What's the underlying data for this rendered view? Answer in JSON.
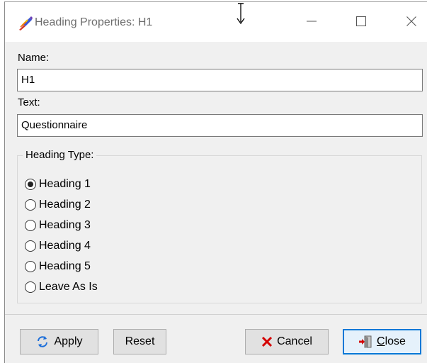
{
  "window": {
    "title": "Heading Properties: H1",
    "icons": {
      "app": "paintbrush-app-icon",
      "minimize": "minimize-icon",
      "maximize": "maximize-icon",
      "close": "close-icon",
      "cursor": "resize-cursor-icon"
    }
  },
  "form": {
    "name_label": "Name:",
    "name_value": "H1",
    "text_label": "Text:",
    "text_value": "Questionnaire"
  },
  "heading_type": {
    "legend": "Heading Type:",
    "selected": "Heading 1",
    "options": [
      {
        "label": "Heading 1",
        "checked": true
      },
      {
        "label": "Heading 2",
        "checked": false
      },
      {
        "label": "Heading 3",
        "checked": false
      },
      {
        "label": "Heading 4",
        "checked": false
      },
      {
        "label": "Heading 5",
        "checked": false
      },
      {
        "label": "Leave As Is",
        "checked": false
      }
    ]
  },
  "buttons": {
    "apply": "Apply",
    "reset": "Reset",
    "cancel": "Cancel",
    "close_mnemonic": "C",
    "close_rest": "lose",
    "icons": {
      "apply": "refresh-icon",
      "cancel": "red-x-icon",
      "close": "exit-door-icon"
    }
  },
  "colors": {
    "focus_border": "#0078d7",
    "cancel_icon": "#d40000",
    "apply_icon": "#1e6fd9",
    "window_bg": "#f0f0f0"
  }
}
